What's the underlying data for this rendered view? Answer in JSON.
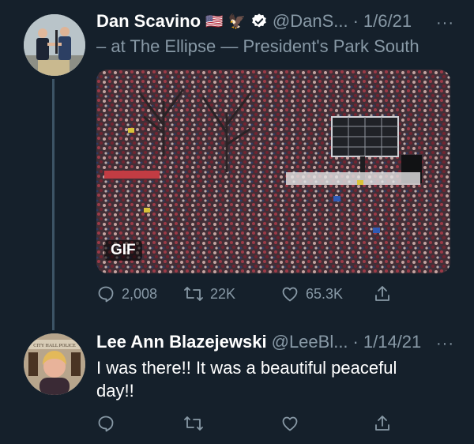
{
  "tweet1": {
    "display_name": "Dan Scavino",
    "flag_emoji": "🇺🇸",
    "eagle_emoji": "🦅",
    "handle": "@DanS...",
    "separator": "·",
    "date": "1/6/21",
    "more": "···",
    "location": "– at The Ellipse — President's Park South",
    "media_badge": "GIF",
    "replies": "2,008",
    "retweets": "22K",
    "likes": "65.3K"
  },
  "tweet2": {
    "display_name": "Lee Ann Blazejewski",
    "handle": "@LeeBl...",
    "separator": "·",
    "date": "1/14/21",
    "more": "···",
    "text": "I was there!! It was a beautiful peaceful day!!",
    "avatar_sign_text": "CITY HALL POLICE"
  },
  "colors": {
    "background": "#15202b",
    "muted_text": "#8899a6",
    "thread_line": "#3d5466",
    "verified_badge": "#ffffff"
  },
  "icons": [
    "reply-icon",
    "retweet-icon",
    "like-icon",
    "share-icon",
    "verified-badge-icon",
    "more-icon"
  ]
}
